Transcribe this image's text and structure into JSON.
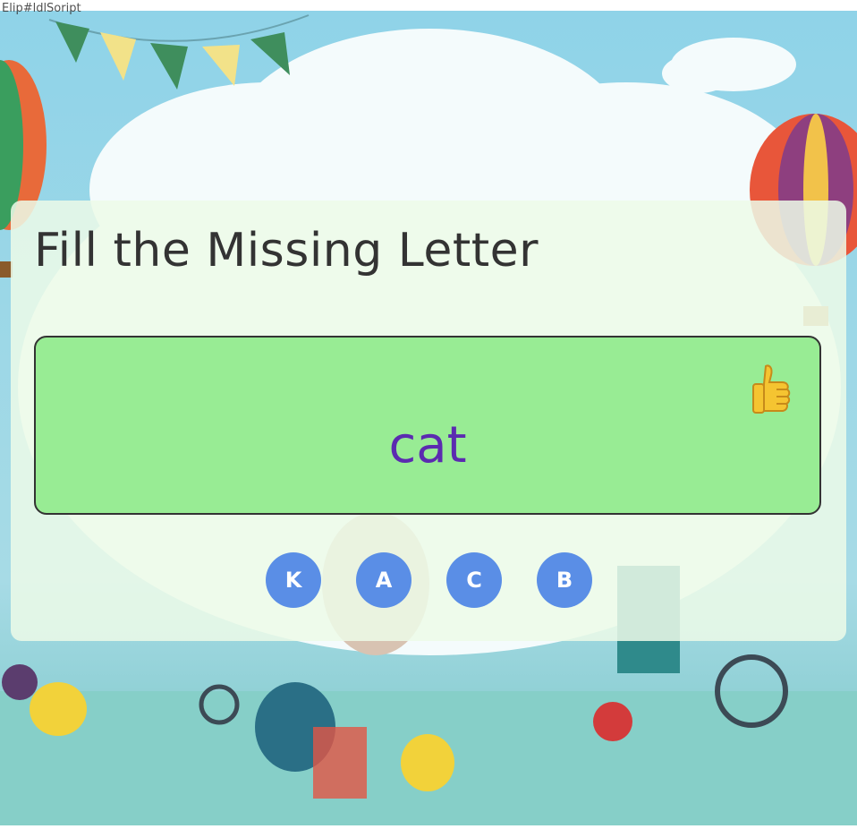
{
  "stray_text": "Elip#ldlSoript",
  "quiz": {
    "title": "Fill the Missing Letter",
    "word": "cat",
    "feedback_icon": "thumbs-up-icon",
    "options": [
      "K",
      "A",
      "C",
      "B"
    ]
  },
  "background": {
    "illustration": "kids playground with hot air balloons, bunting and clouds"
  },
  "colors": {
    "word_box": "#98ec94",
    "word_text": "#5b2bb0",
    "option_button": "#5a8ee6",
    "card_overlay": "#ecfae8"
  }
}
